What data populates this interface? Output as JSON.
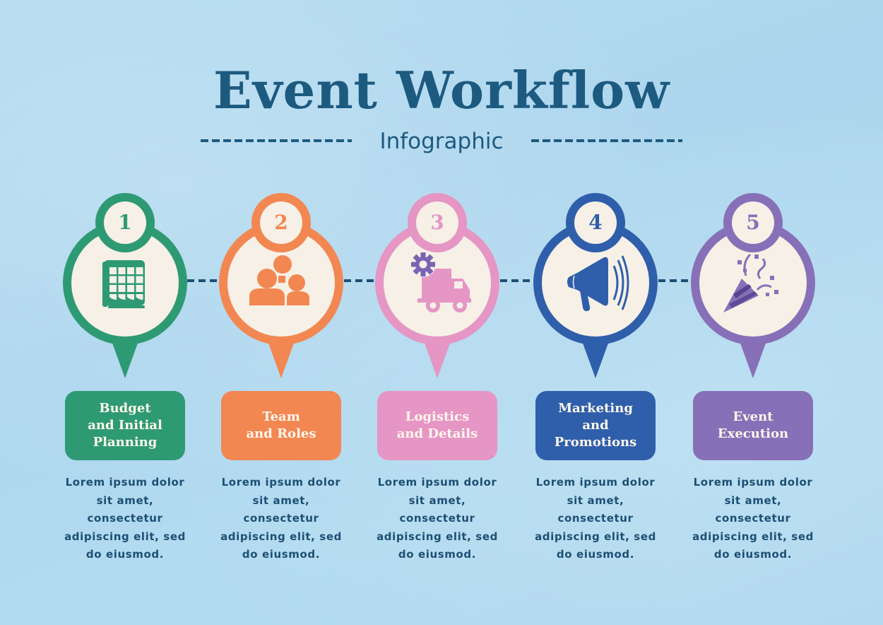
{
  "header": {
    "title": "Event Workflow",
    "subtitle": "Infographic"
  },
  "colors": {
    "background": "#b3dbf0",
    "title": "#1d5a80",
    "body_text": "#1d4f74",
    "circle_fill": "#f7f0e6"
  },
  "steps": [
    {
      "number": "1",
      "icon": "calendar-icon",
      "color": "#2e9a74",
      "label": "Budget\nand Initial\nPlanning",
      "description": [
        "Lorem ipsum dolor",
        "sit amet,",
        "consectetur",
        "adipiscing elit, sed",
        "do eiusmod."
      ]
    },
    {
      "number": "2",
      "icon": "team-icon",
      "color": "#f28752",
      "label": "Team\nand Roles",
      "description": [
        "Lorem ipsum dolor",
        "sit amet,",
        "consectetur",
        "adipiscing elit, sed",
        "do eiusmod."
      ]
    },
    {
      "number": "3",
      "icon": "truck-gear-icon",
      "color": "#e596c4",
      "accent": "#7a63b3",
      "label": "Logistics\nand Details",
      "description": [
        "Lorem ipsum dolor",
        "sit amet,",
        "consectetur",
        "adipiscing elit, sed",
        "do eiusmod."
      ]
    },
    {
      "number": "4",
      "icon": "megaphone-icon",
      "color": "#2f5fab",
      "label": "Marketing\nand\nPromotions",
      "description": [
        "Lorem ipsum dolor",
        "sit amet,",
        "consectetur",
        "adipiscing elit, sed",
        "do eiusmod."
      ]
    },
    {
      "number": "5",
      "icon": "party-popper-icon",
      "color": "#8770b8",
      "accent": "#564592",
      "label": "Event\nExecution",
      "description": [
        "Lorem ipsum dolor",
        "sit amet,",
        "consectetur",
        "adipiscing elit, sed",
        "do eiusmod."
      ]
    }
  ]
}
